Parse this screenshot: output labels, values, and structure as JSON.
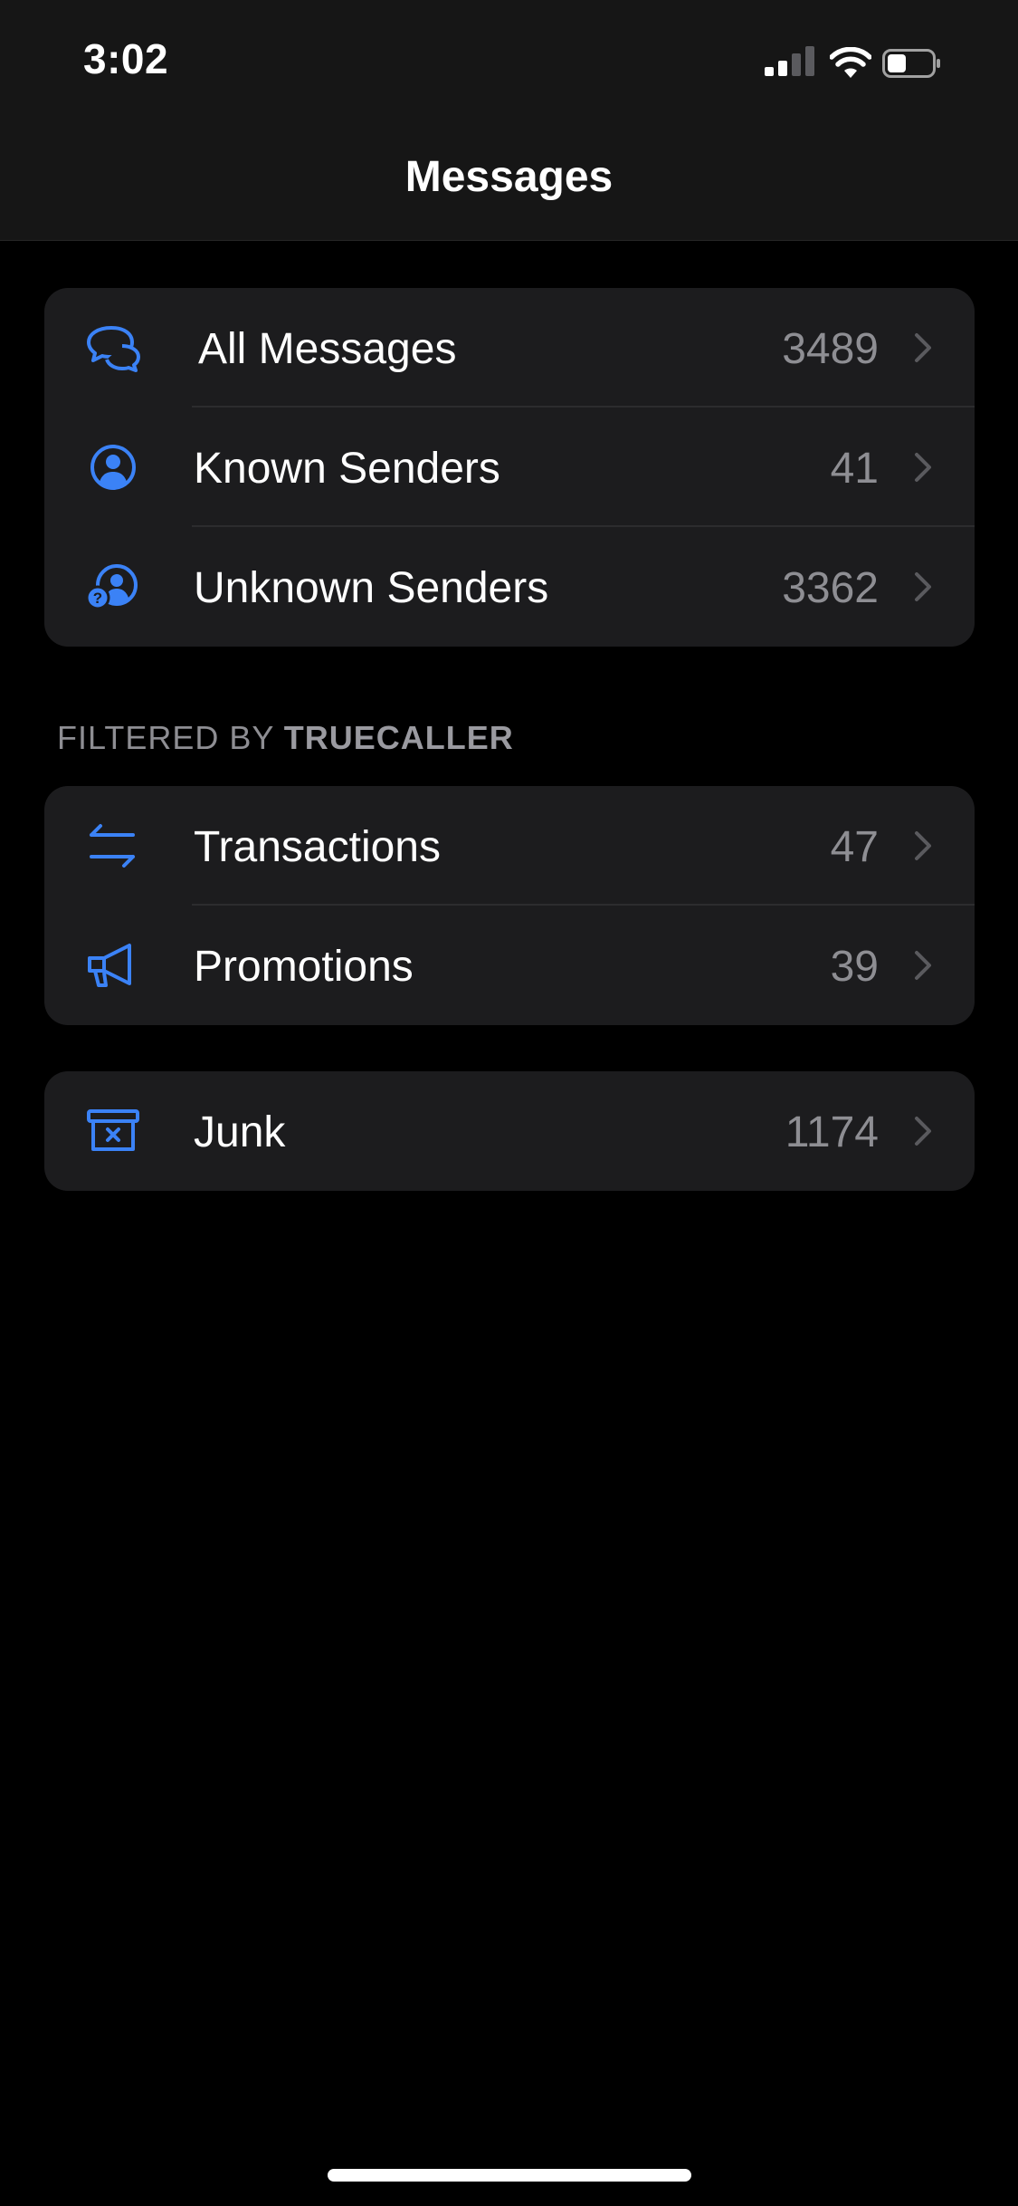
{
  "status_bar": {
    "time": "3:02"
  },
  "nav": {
    "title": "Messages"
  },
  "inbox_group": {
    "items": [
      {
        "label": "All Messages",
        "count": "3489",
        "icon": "chat-bubbles-icon"
      },
      {
        "label": "Known Senders",
        "count": "41",
        "icon": "person-circle-icon"
      },
      {
        "label": "Unknown Senders",
        "count": "3362",
        "icon": "unknown-person-icon"
      }
    ]
  },
  "filtered_section": {
    "header_prefix": "FILTERED BY ",
    "header_brand": "TRUECALLER",
    "items": [
      {
        "label": "Transactions",
        "count": "47",
        "icon": "transfer-arrows-icon"
      },
      {
        "label": "Promotions",
        "count": "39",
        "icon": "megaphone-icon"
      }
    ]
  },
  "junk_group": {
    "items": [
      {
        "label": "Junk",
        "count": "1174",
        "icon": "junk-box-icon"
      }
    ]
  },
  "colors": {
    "accent": "#3b82f6",
    "background": "#000000",
    "card": "#1c1c1e",
    "secondary_text": "#8e8e93"
  }
}
